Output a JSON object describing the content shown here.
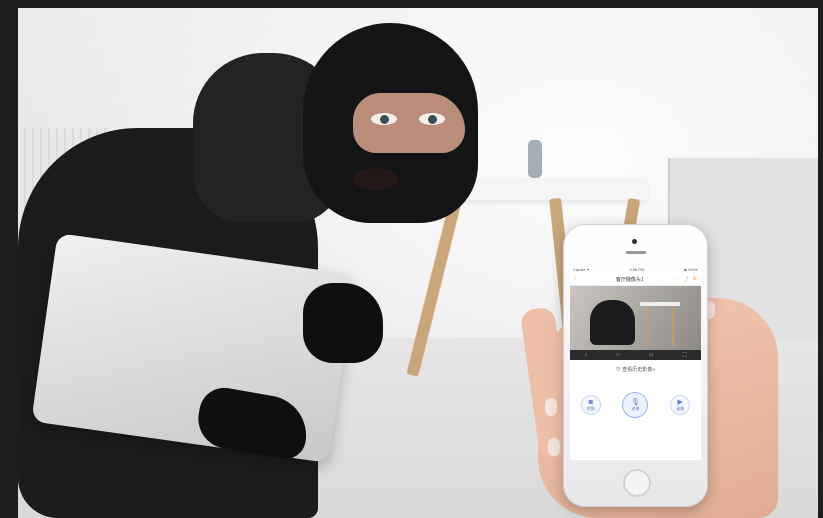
{
  "phone_app": {
    "status_bar": {
      "carrier": "Carrier ✦",
      "time": "4:56 PM",
      "battery": "■ 100%"
    },
    "title": "客厅摄像头1",
    "history_label": "查看历史影像»",
    "buttons": [
      {
        "icon": "camera-icon",
        "label": "拍照"
      },
      {
        "icon": "microphone-icon",
        "label": "对讲"
      },
      {
        "icon": "video-icon",
        "label": "录像"
      }
    ]
  },
  "colors": {
    "accent": "#f5a623",
    "button_blue": "#6a7fcf",
    "hoodie": "#1c1c1e"
  }
}
